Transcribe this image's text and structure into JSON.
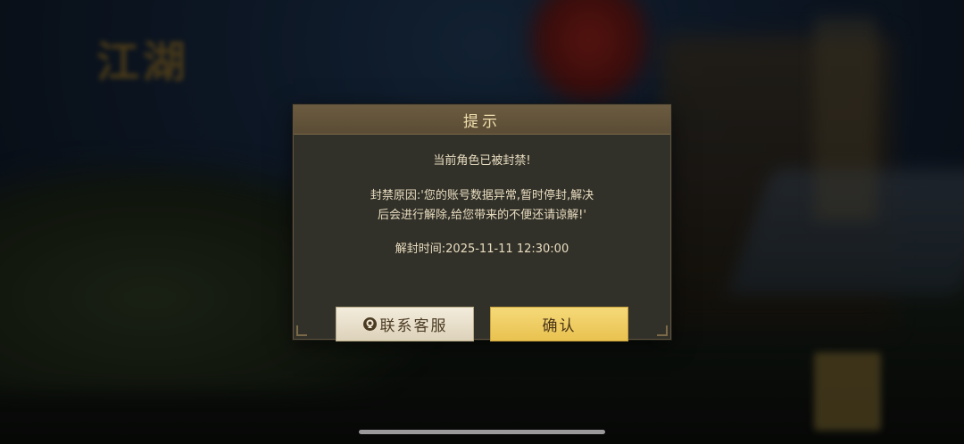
{
  "background": {
    "logo_text": "江湖"
  },
  "dialog": {
    "title": "提示",
    "line_banned": "当前角色已被封禁!",
    "reason_line1": "封禁原因:'您的账号数据异常,暂时停封,解决",
    "reason_line2": "后会进行解除,给您带来的不便还请谅解!'",
    "unban_time": "解封时间:2025-11-11 12:30:00",
    "contact_button": "联系客服",
    "confirm_button": "确认"
  },
  "colors": {
    "header_text": "#f2dfae",
    "body_text": "#e8dcc0",
    "confirm_bg": "#f5d978",
    "service_bg": "#f3ecdc"
  },
  "icons": {
    "contact": "customer-service-icon"
  }
}
